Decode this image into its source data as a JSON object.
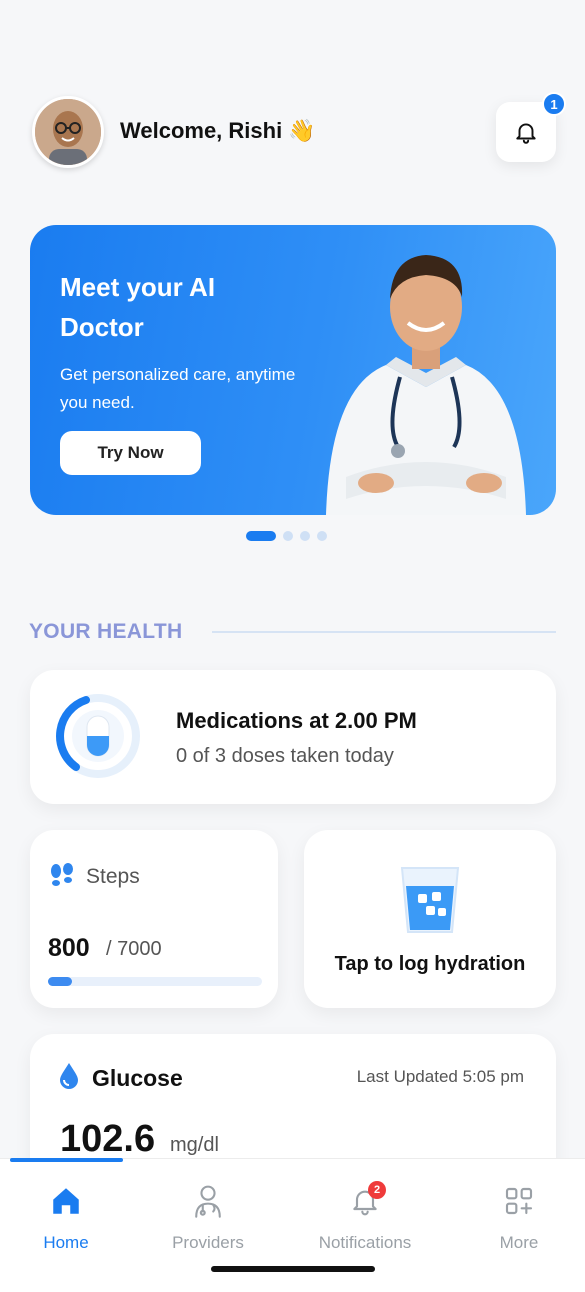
{
  "header": {
    "welcome_text": "Welcome, Rishi 👋",
    "notification_count": "1"
  },
  "banner": {
    "title": "Meet your AI Doctor",
    "subtitle": "Get personalized care, anytime you need.",
    "cta_label": "Try Now"
  },
  "carousel": {
    "page_count": 4,
    "active_index": 0
  },
  "health": {
    "section_title": "YOUR HEALTH",
    "medications": {
      "title": "Medications at 2.00 PM",
      "subtitle": "0 of 3 doses taken today"
    },
    "steps": {
      "label": "Steps",
      "value": "800",
      "goal": "/ 7000",
      "progress_fraction": 0.114
    },
    "hydration": {
      "label": "Tap to log hydration"
    },
    "glucose": {
      "label": "Glucose",
      "last_updated": "Last Updated  5:05 pm",
      "value": "102.6",
      "unit": "mg/dl"
    }
  },
  "tabbar": {
    "tabs": [
      {
        "label": "Home",
        "icon": "home-icon",
        "active": true
      },
      {
        "label": "Providers",
        "icon": "doctor-icon",
        "active": false
      },
      {
        "label": "Notifications",
        "icon": "bell-icon",
        "active": false,
        "badge": "2"
      },
      {
        "label": "More",
        "icon": "grid-plus-icon",
        "active": false
      }
    ]
  },
  "colors": {
    "accent": "#1a7cf0",
    "section_title": "#8a96d8",
    "badge_red": "#ef3b3b"
  }
}
